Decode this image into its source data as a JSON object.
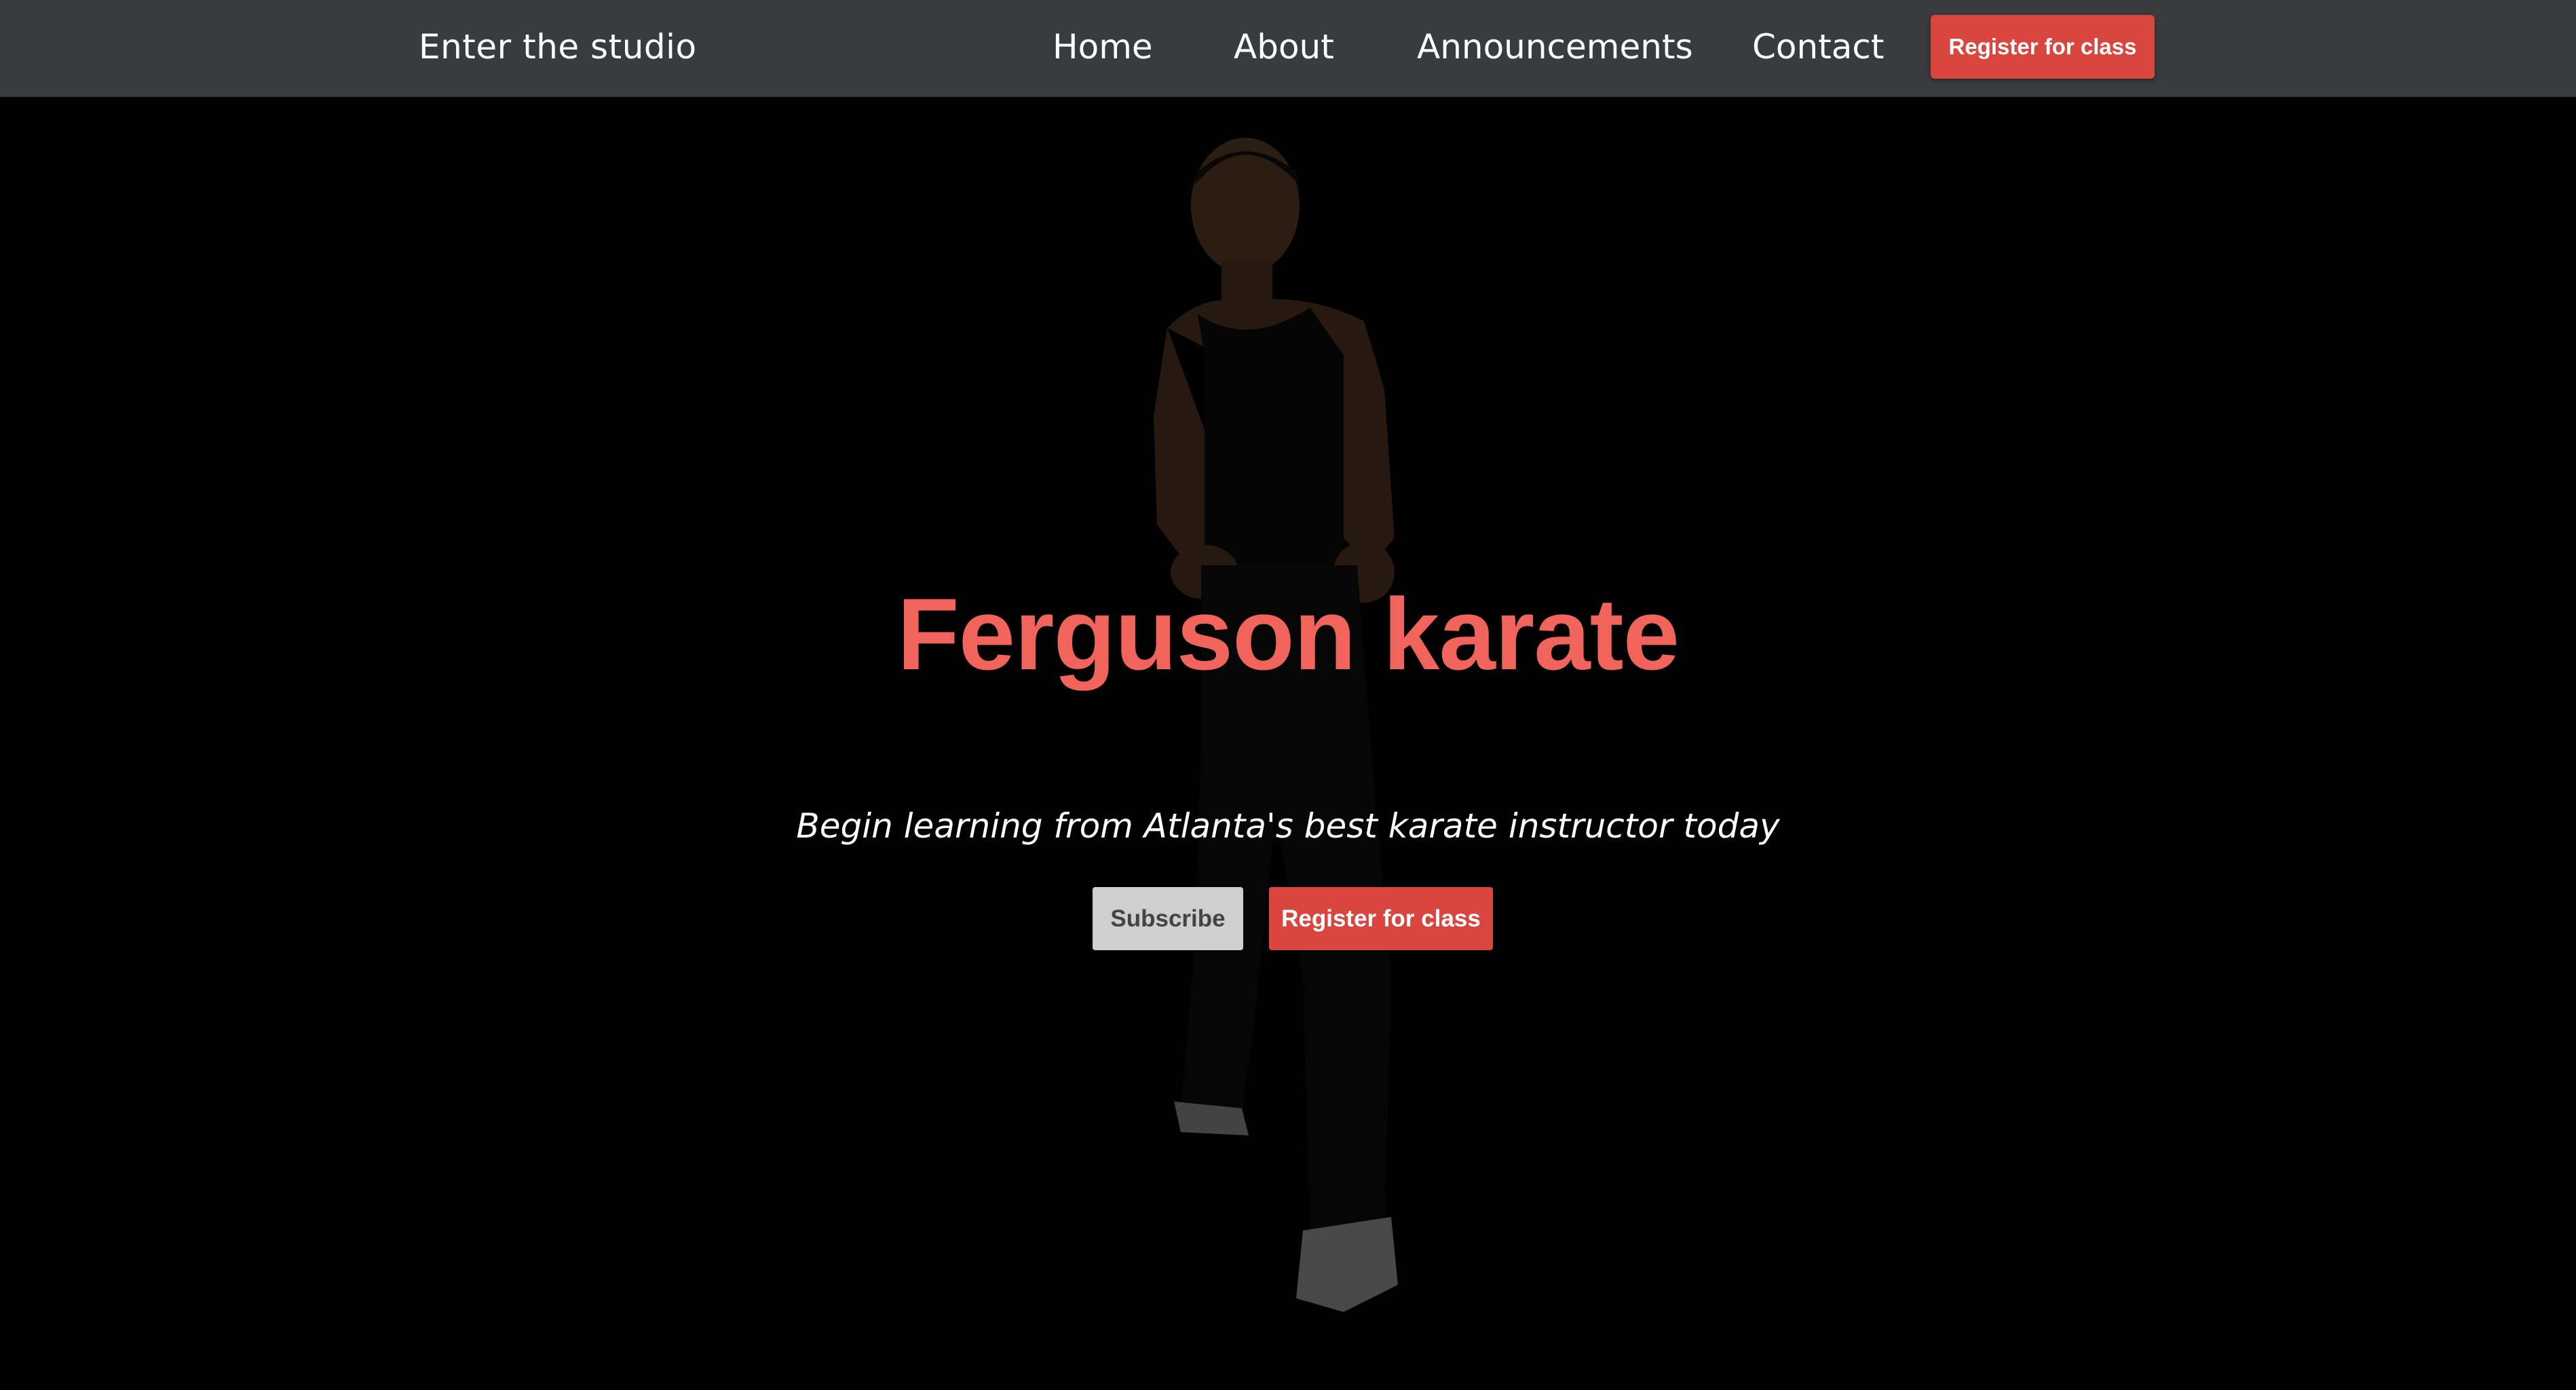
{
  "navbar": {
    "brand": "Enter the studio",
    "links": [
      {
        "label": "Home"
      },
      {
        "label": "About"
      },
      {
        "label": "Announcements"
      },
      {
        "label": "Contact"
      }
    ],
    "register_label": "Register for class"
  },
  "hero": {
    "title": "Ferguson karate",
    "subtitle": "Begin learning from Atlanta's best karate instructor today",
    "subscribe_label": "Subscribe",
    "register_label": "Register for class"
  },
  "colors": {
    "navbar_bg": "#3a3b3d",
    "accent_red": "#d9463f",
    "title_red": "#f0645c",
    "hero_bg": "#000000",
    "subscribe_bg": "#cfcfcf"
  }
}
